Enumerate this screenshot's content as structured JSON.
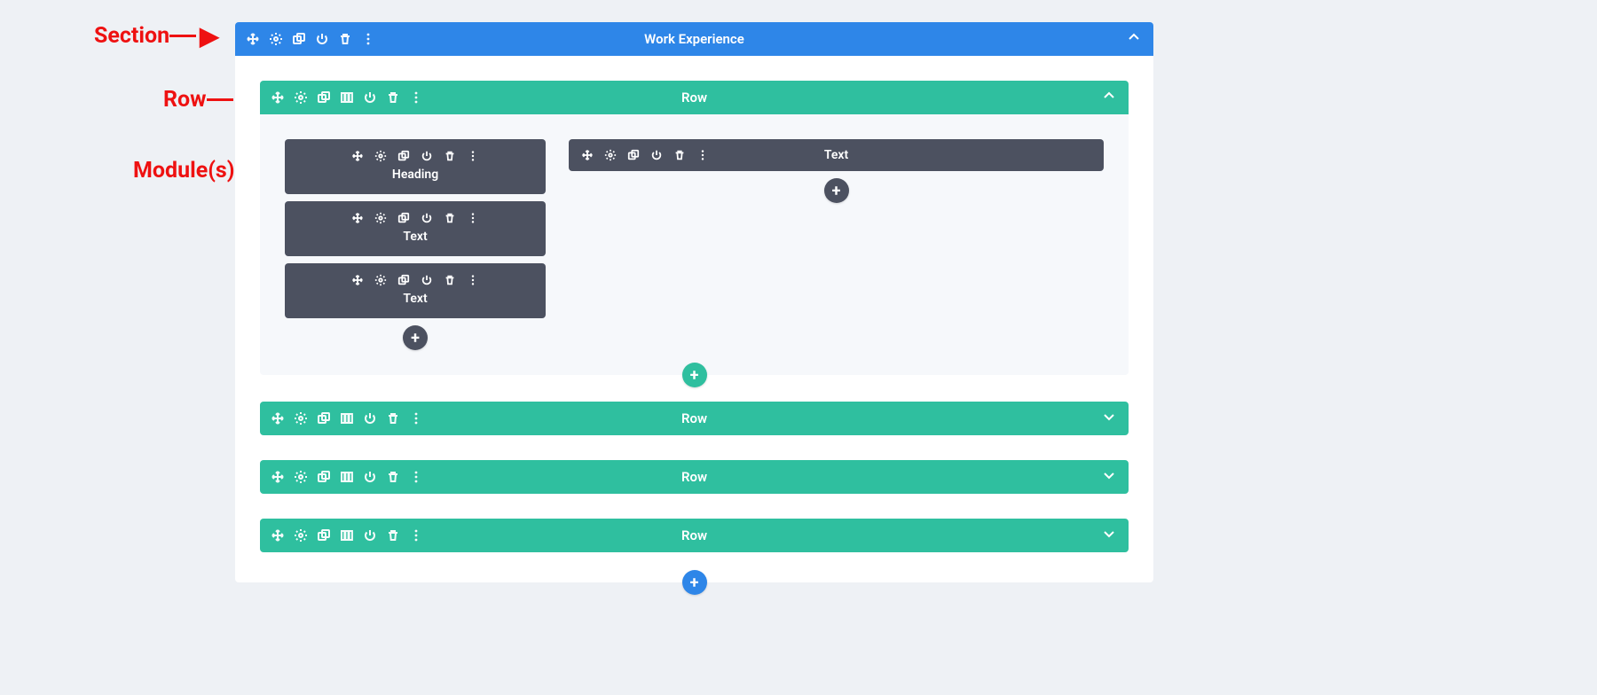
{
  "annotations": {
    "section": "Section",
    "row": "Row",
    "modules": "Module(s)"
  },
  "section": {
    "title": "Work Experience"
  },
  "row1": {
    "title": "Row",
    "col1": {
      "m1": "Heading",
      "m2": "Text",
      "m3": "Text"
    },
    "col2": {
      "m1": "Text"
    }
  },
  "row2": {
    "title": "Row"
  },
  "row3": {
    "title": "Row"
  },
  "row4": {
    "title": "Row"
  },
  "glyph": {
    "plus": "+"
  }
}
